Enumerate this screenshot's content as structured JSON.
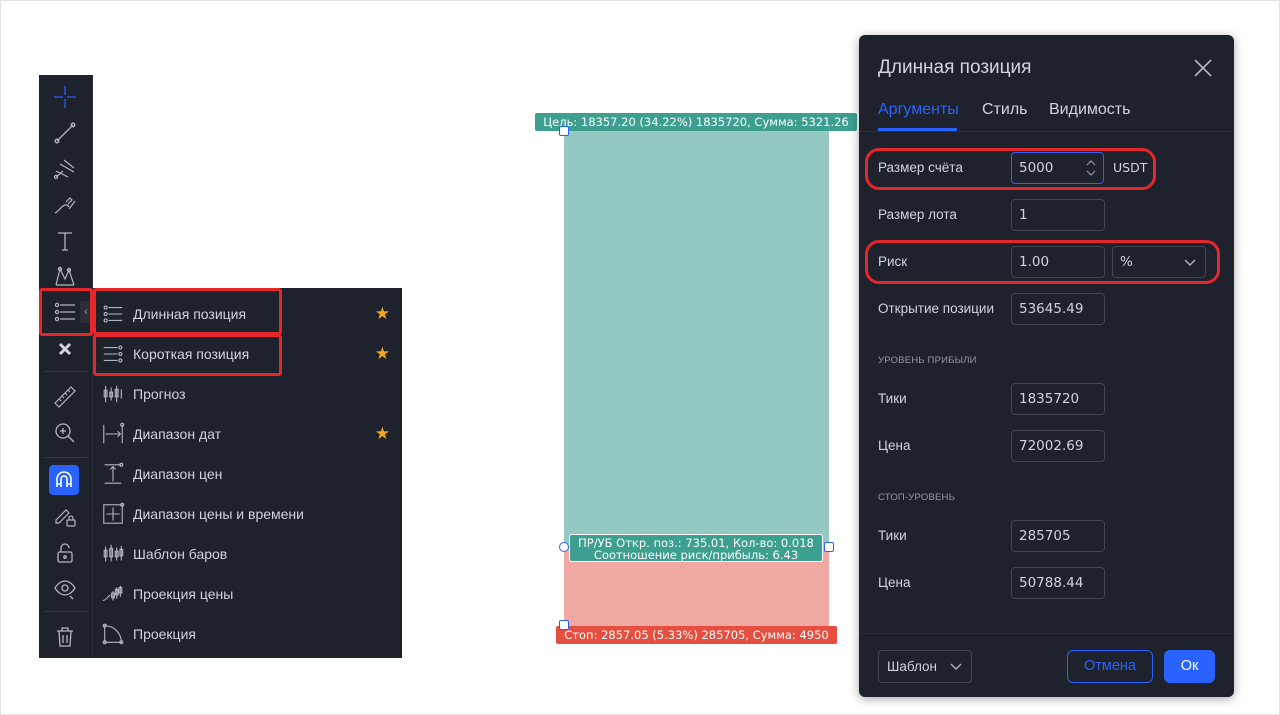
{
  "toolbar": {
    "tools": [
      {
        "icon": "crosshair-icon"
      },
      {
        "icon": "trend-line-icon"
      },
      {
        "icon": "fib-pitchfork-icon"
      },
      {
        "icon": "brush-icon"
      },
      {
        "icon": "text-icon"
      },
      {
        "icon": "pattern-icon"
      },
      {
        "icon": "long-position-icon"
      },
      {
        "icon": "close-icon"
      },
      {
        "icon": "ruler-icon"
      },
      {
        "icon": "zoom-in-icon"
      },
      {
        "icon": "magnet-icon"
      },
      {
        "icon": "lock-drawing-icon"
      },
      {
        "icon": "unlock-icon"
      },
      {
        "icon": "eye-icon"
      },
      {
        "icon": "trash-icon"
      }
    ],
    "accent": "#2962ff"
  },
  "flyout": {
    "items": [
      {
        "label": "Длинная позиция",
        "favorite": true,
        "icon": "long-position-icon"
      },
      {
        "label": "Короткая позиция",
        "favorite": true,
        "icon": "short-position-icon"
      },
      {
        "label": "Прогноз",
        "favorite": false,
        "icon": "forecast-icon"
      },
      {
        "label": "Диапазон дат",
        "favorite": true,
        "icon": "date-range-icon"
      },
      {
        "label": "Диапазон цен",
        "favorite": false,
        "icon": "price-range-icon"
      },
      {
        "label": "Диапазон цены и времени",
        "favorite": false,
        "icon": "date-price-range-icon"
      },
      {
        "label": "Шаблон баров",
        "favorite": false,
        "icon": "bars-pattern-icon"
      },
      {
        "label": "Проекция цены",
        "favorite": false,
        "icon": "price-projection-icon"
      },
      {
        "label": "Проекция",
        "favorite": false,
        "icon": "projection-icon"
      }
    ],
    "star_glyph": "★",
    "star_color": "#f7a21b"
  },
  "position": {
    "target_label": "Цель: 18357.20 (34.22%) 1835720, Сумма: 5321.26",
    "pnl_line1": "ПР/УБ Откр. поз.: 735.01, Кол-во: 0.018",
    "pnl_line2": "Соотношение риск/прибыль: 6.43",
    "stop_label": "Стоп: 2857.05 (5.33%) 285705, Сумма: 4950",
    "profit_color": "#93c8c3",
    "loss_color": "#efa8a2"
  },
  "dialog": {
    "title": "Длинная позиция",
    "tabs": [
      "Аргументы",
      "Стиль",
      "Видимость"
    ],
    "active_tab": "Аргументы",
    "account_size_label": "Размер счёта",
    "account_size_value": "5000",
    "account_currency": "USDT",
    "lot_size_label": "Размер лота",
    "lot_size_value": "1",
    "risk_label": "Риск",
    "risk_value": "1.00",
    "risk_unit": "%",
    "entry_label": "Открытие позиции",
    "entry_value": "53645.49",
    "profit_section": "УРОВЕНЬ ПРИБЫЛИ",
    "profit_ticks_label": "Тики",
    "profit_ticks_value": "1835720",
    "profit_price_label": "Цена",
    "profit_price_value": "72002.69",
    "stop_section": "СТОП-УРОВЕНЬ",
    "stop_ticks_label": "Тики",
    "stop_ticks_value": "285705",
    "stop_price_label": "Цена",
    "stop_price_value": "50788.44",
    "template_label": "Шаблон",
    "cancel_label": "Отмена",
    "ok_label": "Ок"
  },
  "highlight_color": "#e5262a"
}
